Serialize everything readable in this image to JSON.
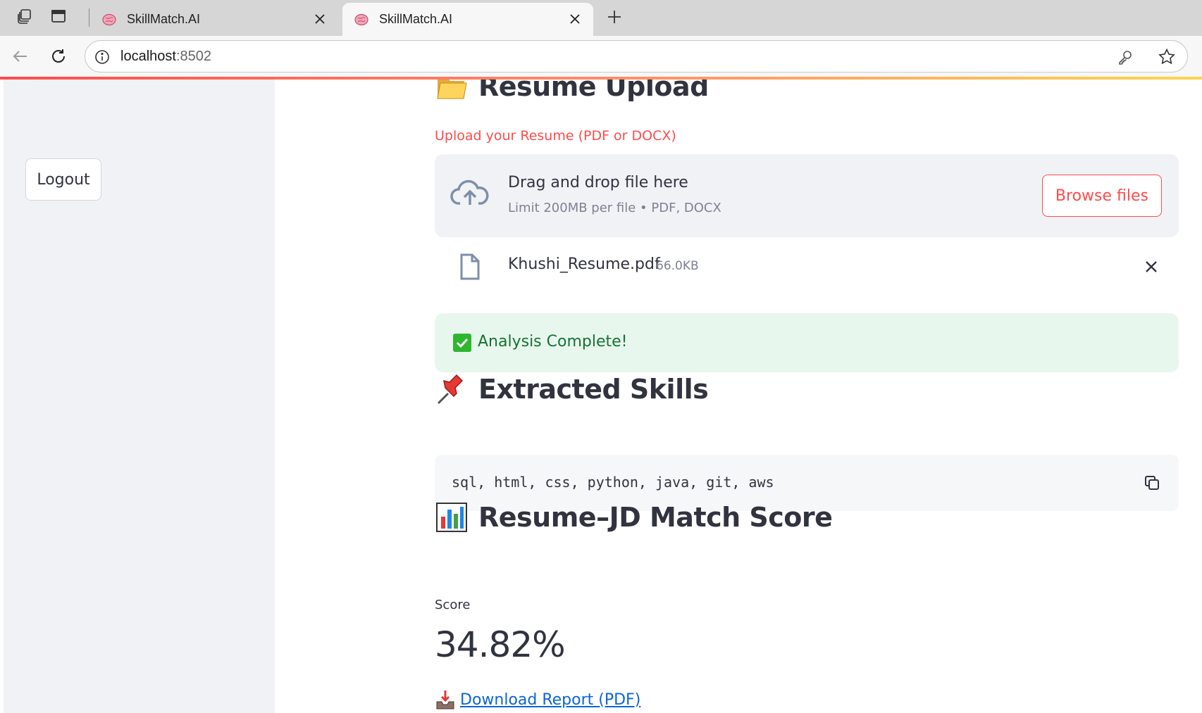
{
  "browser": {
    "tabs": [
      {
        "title": "SkillMatch.AI",
        "active": false
      },
      {
        "title": "SkillMatch.AI",
        "active": true
      }
    ],
    "url_host": "localhost",
    "url_port": ":8502"
  },
  "sidebar": {
    "logout_label": "Logout"
  },
  "upload_section": {
    "heading": "Resume Upload",
    "heading_icon": "folder-emoji",
    "label": "Upload your Resume (PDF or DOCX)",
    "dropzone_title": "Drag and drop file here",
    "dropzone_limit": "Limit 200MB per file • PDF, DOCX",
    "browse_label": "Browse files",
    "file": {
      "name": "Khushi_Resume.pdf",
      "size": "66.0KB"
    }
  },
  "status": {
    "message": "Analysis Complete!",
    "color": "#177233"
  },
  "skills_section": {
    "heading": "Extracted Skills",
    "heading_icon": "pushpin-emoji",
    "skills_text": "sql, html, css, python, java, git, aws"
  },
  "score_section": {
    "heading": "Resume–JD Match Score",
    "heading_icon": "bar-chart-emoji",
    "metric_label": "Score",
    "metric_value": "34.82%"
  },
  "download": {
    "label": "Download Report (PDF)"
  },
  "colors": {
    "accent": "#ff4b4b",
    "sidebar_bg": "#f0f2f6",
    "link": "#0b66d6"
  }
}
